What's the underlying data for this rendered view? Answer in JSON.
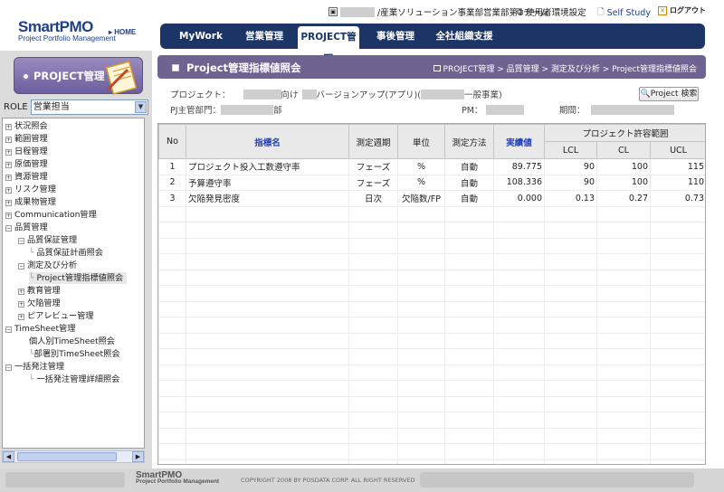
{
  "topbar": {
    "team": "/産業ソリューション事業部営業部第1チーム",
    "env_settings": "使用者環境設定",
    "self_study": "Self Study",
    "logout": "ログアウト"
  },
  "logo": {
    "main": "SmartPMO",
    "sub": "Project Portfolio Management",
    "home": "▸ HOME"
  },
  "nav": [
    "MyWork",
    "営業管理",
    "PROJECT管理",
    "事後管理",
    "全社組織支援"
  ],
  "sidebar": {
    "banner": "PROJECT管理",
    "role_label": "ROLE",
    "role_value": "営業担当",
    "tree": [
      {
        "label": "状況照会",
        "box": "+"
      },
      {
        "label": "範囲管理",
        "box": "+"
      },
      {
        "label": "日程管理",
        "box": "+"
      },
      {
        "label": "原価管理",
        "box": "+"
      },
      {
        "label": "資源管理",
        "box": "+"
      },
      {
        "label": "リスク管理",
        "box": "+"
      },
      {
        "label": "成果物管理",
        "box": "+"
      },
      {
        "label": "Communication管理",
        "box": "+"
      },
      {
        "label": "品質管理",
        "box": "−"
      },
      {
        "label": "品質保証管理",
        "box": "−"
      },
      {
        "label": "品質保証計画照会",
        "box": ""
      },
      {
        "label": "測定及び分析",
        "box": "−"
      },
      {
        "label": "Project管理指標値照会",
        "box": ""
      },
      {
        "label": "教育管理",
        "box": "+"
      },
      {
        "label": "欠陥管理",
        "box": "+"
      },
      {
        "label": "ピアレビュー管理",
        "box": "+"
      },
      {
        "label": "TimeSheet管理",
        "box": "−"
      },
      {
        "label": "個人別TimeSheet照会",
        "box": ""
      },
      {
        "label": "部署別TimeSheet照会",
        "box": ""
      },
      {
        "label": "一括発注管理",
        "box": "−"
      },
      {
        "label": "一括発注管理詳細照会",
        "box": ""
      }
    ]
  },
  "page": {
    "title": "Project管理指標値照会",
    "breadcrumb": "PROJECT管理 > 品質管理 > 測定及び分析 > Project管理指標値照会"
  },
  "info": {
    "project_label": "プロジェクト：",
    "project_mid1": "向け",
    "project_mid2": "バージョンアップ(アプリ)(",
    "project_mid3": "一般事業)",
    "dept_label": "PJ主管部門：",
    "dept_suffix": "部",
    "pm_label": "PM：",
    "period_label": "期間：",
    "search_button": "Project 検索"
  },
  "table": {
    "headers": {
      "no": "No",
      "indicator": "指標名",
      "cycle": "測定週期",
      "unit": "単位",
      "method": "測定方法",
      "actual": "実績値",
      "range": "プロジェクト許容範囲",
      "lcl": "LCL",
      "cl": "CL",
      "ucl": "UCL"
    },
    "rows": [
      {
        "no": "1",
        "name": "プロジェクト投入工数遵守率",
        "cycle": "フェーズ",
        "unit": "%",
        "method": "自動",
        "actual": "89.775",
        "lcl": "90",
        "cl": "100",
        "ucl": "115"
      },
      {
        "no": "2",
        "name": "予算遵守率",
        "cycle": "フェーズ",
        "unit": "%",
        "method": "自動",
        "actual": "108.336",
        "lcl": "90",
        "cl": "100",
        "ucl": "110"
      },
      {
        "no": "3",
        "name": "欠陥発見密度",
        "cycle": "日次",
        "unit": "欠陥数/FP",
        "method": "自動",
        "actual": "0.000",
        "lcl": "0.13",
        "cl": "0.27",
        "ucl": "0.73"
      }
    ]
  },
  "footer": {
    "logo_main": "SmartPMO",
    "logo_sub": "Project Portfolio Management",
    "copyright": "COPYRIGHT 2008 BY POSDATA CORP. ALL RIGHT RESERVED"
  },
  "colors": {
    "nav_bg": "#1d3566",
    "title_bg": "#6f6391",
    "banner": "#7b6caa"
  }
}
